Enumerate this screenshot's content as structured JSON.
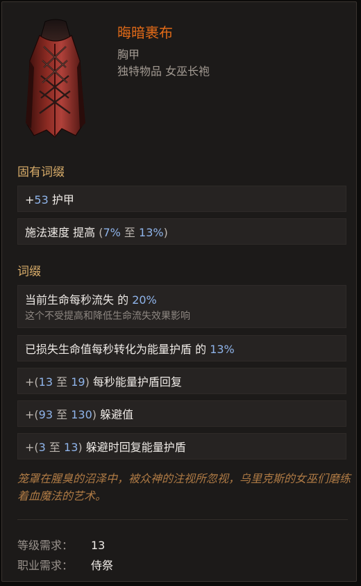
{
  "item": {
    "name": "晦暗裹布",
    "type": "胸甲",
    "rarity_line": "独特物品 女巫长袍",
    "image_icon": "robe-icon"
  },
  "implicit": {
    "title": "固有词缀",
    "rows": [
      {
        "prefix": "+",
        "num1": "53",
        "text": " 护甲"
      },
      {
        "text": "施法速度 提高 ",
        "open": "(",
        "num1": "7%",
        "mid": " 至 ",
        "num2": "13%",
        "close": ")"
      }
    ]
  },
  "explicit": {
    "title": "词缀",
    "rows": [
      {
        "text": "当前生命每秒流失 的 ",
        "num1": "20%",
        "note": "这个不受提高和降低生命流失效果影响"
      },
      {
        "text": "已损失生命值每秒转化为能量护盾 的 ",
        "num1": "13%"
      },
      {
        "prefix": "+(",
        "num1": "13",
        "mid": " 至 ",
        "num2": "19",
        "close": ")",
        "text": " 每秒能量护盾回复"
      },
      {
        "prefix": "+(",
        "num1": "93",
        "mid": " 至 ",
        "num2": "130",
        "close": ")",
        "text": " 躲避值"
      },
      {
        "prefix": "+(",
        "num1": "3",
        "mid": " 至 ",
        "num2": "13",
        "close": ")",
        "text": " 躲避时回复能量护盾"
      }
    ]
  },
  "flavor_text": "笼罩在腥臭的沼泽中，被众神的注视所忽视，乌里克斯的女巫们磨练着血魔法的艺术。",
  "requirements": {
    "level_label": "等级需求：",
    "level_value": "13",
    "class_label": "职业需求：",
    "class_value": "侍祭"
  },
  "colors": {
    "name": "#e06a18",
    "section_title": "#d9ad6a",
    "number": "#8fb4ea",
    "flavor": "#b07b45"
  }
}
